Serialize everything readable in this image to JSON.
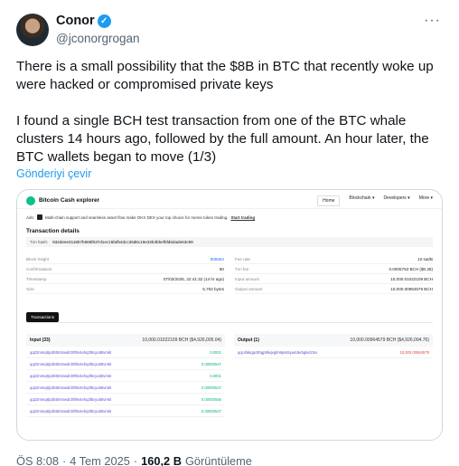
{
  "author": {
    "name": "Conor",
    "handle": "@jconorgrogan",
    "more_label": "···"
  },
  "tweet": {
    "paragraph1": "There is a small possibility that the $8B in BTC that recently woke up were hacked or compromised private keys",
    "paragraph2": "I found a single BCH test transaction from one of the BTC whale clusters 14 hours ago, followed by the full amount. An hour later, the BTC wallets began to move (1/3)",
    "translate_label": "Gönderiyi çevir"
  },
  "explorer": {
    "title": "Bitcoin Cash explorer",
    "menu": [
      "Home",
      "Blockchain ▾",
      "Developers ▾",
      "More ▾"
    ],
    "ad_prefix": "Ads:",
    "ad_text": "Multi-chain support and seamless asset flow make OKX DEX your top choice for meme token trading.",
    "ad_link": "Start trading",
    "details_title": "Transaction details",
    "hash_label": "Txn hash:",
    "hash_value": "932deee311857b585f637d1ec15faf54dcc35d6c19e32b3bbefbfd6dade53c99",
    "left_fields": [
      {
        "k": "Block height",
        "v": "905564"
      },
      {
        "k": "Confirmations",
        "v": "80"
      },
      {
        "k": "Timestamp",
        "v": "07/03/2025, 22:41:32 (14 hr ago)"
      },
      {
        "k": "Size",
        "v": "5,753 bytes"
      }
    ],
    "right_fields": [
      {
        "k": "Fee rate",
        "v": "10 sat/B"
      },
      {
        "k": "Txn fee",
        "v": "0.0005753 BCH ($0.28)"
      },
      {
        "k": "Input amount",
        "v": "10,000.01022109 BCH"
      },
      {
        "k": "Output amount",
        "v": "10,000.00964579 BCH"
      }
    ],
    "tab_label": "Transactions",
    "input_header": "Input (33)",
    "input_amount": "10,000.01022109 BCH ($4,926,005.04)",
    "output_header": "Output (1)",
    "output_amount": "10,000.00964579 BCH ($4,926,004.76)",
    "inputs": [
      {
        "addr": "qq22mmq8jcd5ttmtnwdr20f8n4ehq3l5cyu5ttvmkt",
        "amt": "0.0001"
      },
      {
        "addr": "qq22mmq8jcd5ttmtnwdr20f8n4ehq3l5cyu5ttvmkt",
        "amt": "0.00000547"
      },
      {
        "addr": "qq22mmq8jcd5ttmtnwdr20f8n4ehq3l5cyu5ttvmkt",
        "amt": "0.0001"
      },
      {
        "addr": "qq22mmq8jcd5ttmtnwdr20f8n4ehq3l5cyu5ttvmkt",
        "amt": "0.00000547"
      },
      {
        "addr": "qq22mmq8jcd5ttmtnwdr20f8n4ehq3l5cyu5ttvmkt",
        "amt": "0.00000555"
      },
      {
        "addr": "qq22mmq8jcd5ttmtnwdr20f8n4ehq3l5cyu5ttvmkt",
        "amt": "0.00000547"
      }
    ],
    "outputs": [
      {
        "addr": "qqcxfakgqc8hgp8lwjvglm9pss5ya4der5gkvtztnx",
        "amt": "10,000.00964579"
      }
    ]
  },
  "footer": {
    "time": "ÖS 8:08",
    "sep1": "·",
    "date": "4 Tem 2025",
    "sep2": "·",
    "views": "160,2 B",
    "views_label": "Görüntüleme"
  },
  "colors": {
    "link": "#1d9bf0",
    "verified": "#1d9bf0",
    "bch_green": "#0ac18e"
  }
}
